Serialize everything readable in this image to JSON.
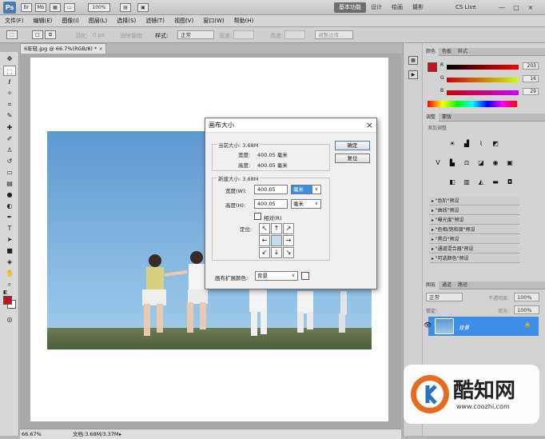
{
  "app": {
    "logo": "Ps",
    "workspace": [
      "基本功能",
      "设计",
      "绘画",
      "摄影"
    ],
    "cs_live": "CS Live",
    "window_buttons": [
      "—",
      "□",
      "×"
    ]
  },
  "menus": [
    "文件(F)",
    "编辑(E)",
    "图像(I)",
    "图层(L)",
    "选择(S)",
    "滤镜(T)",
    "视图(V)",
    "窗口(W)",
    "帮助(H)"
  ],
  "options": {
    "feather_label": "羽化:",
    "feather_value": "0 px",
    "antialias": "消除锯齿",
    "style_label": "样式:",
    "style_value": "正常",
    "width_label": "宽度:",
    "height_label": "高度:",
    "refine_edge": "调整边缘..."
  },
  "document": {
    "tab_title": "6年轻.jpg @ 66.7%(RGB/8) *",
    "zoom": "66.67%",
    "doc_info": "文档:3.68M/3.37M"
  },
  "dialog": {
    "title": "画布大小",
    "current_size_label": "当前大小: 3.68M",
    "current_width_label": "宽度:",
    "current_width_value": "400.05 毫米",
    "current_height_label": "高度:",
    "current_height_value": "400.05 毫米",
    "new_size_label": "新建大小: 3.68M",
    "width_label": "宽度(W):",
    "width_value": "400.05",
    "width_unit": "毫米",
    "height_label": "高度(H):",
    "height_value": "400.05",
    "height_unit": "毫米",
    "relative_label": "相对(R)",
    "anchor_label": "定位:",
    "extension_color_label": "画布扩展颜色:",
    "extension_color_value": "背景",
    "ok_label": "确定",
    "reset_label": "复位"
  },
  "color_panel": {
    "tabs": [
      "颜色",
      "色板",
      "样式"
    ],
    "r": "203",
    "g": "16",
    "b": "29",
    "swatch": "#cb101d"
  },
  "adjustments": {
    "tabs": [
      "调整",
      "蒙版"
    ],
    "heading": "添加调整",
    "presets": [
      "\"色阶\"预设",
      "\"曲线\"预设",
      "\"曝光度\"预设",
      "\"色相/饱和度\"预设",
      "\"黑白\"预设",
      "\"通道混合器\"预设",
      "\"可选颜色\"预设"
    ]
  },
  "layers": {
    "tabs": [
      "图层",
      "通道",
      "路径"
    ],
    "blend_mode": "正常",
    "opacity_label": "不透明度:",
    "opacity_value": "100%",
    "lock_label": "锁定:",
    "fill_label": "填充:",
    "fill_value": "100%",
    "layer_name": "背景"
  },
  "watermark": {
    "brand": "酷知网",
    "url": "www.coozhi.com"
  },
  "colors": {
    "foreground": "#c8101e",
    "background": "#ffffff",
    "accent": "#3d8ee6"
  }
}
